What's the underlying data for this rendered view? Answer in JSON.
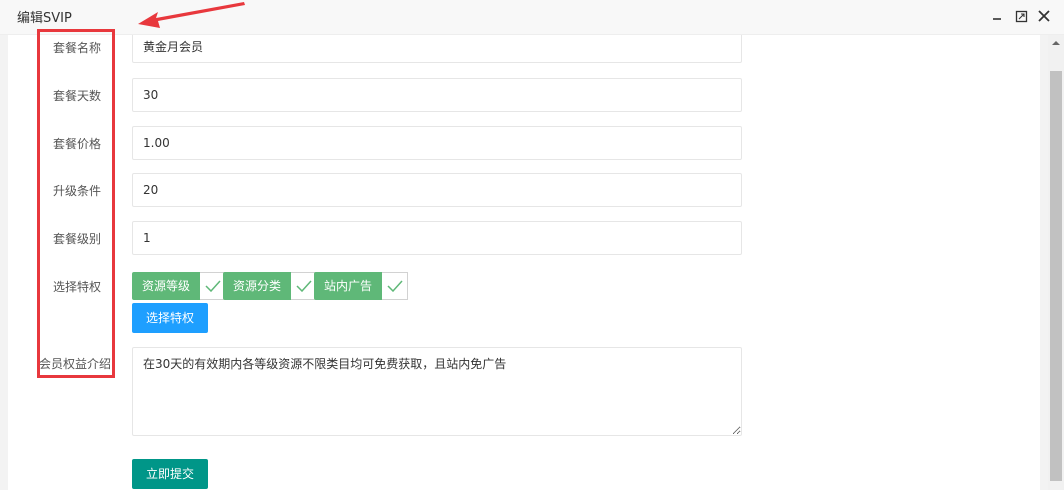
{
  "window": {
    "title": "编辑SVIP",
    "minimize_icon": "minimize-icon",
    "maximize_icon": "maximize-icon",
    "close_icon": "close-icon"
  },
  "form": {
    "name": {
      "label": "套餐名称",
      "value": "黄金月会员"
    },
    "days": {
      "label": "套餐天数",
      "value": "30"
    },
    "price": {
      "label": "套餐价格",
      "value": "1.00"
    },
    "upgrade": {
      "label": "升级条件",
      "value": "20"
    },
    "level": {
      "label": "套餐级别",
      "value": "1"
    },
    "privileges": {
      "label": "选择特权",
      "items": [
        {
          "label": "资源等级",
          "checked": true
        },
        {
          "label": "资源分类",
          "checked": true
        },
        {
          "label": "站内广告",
          "checked": true
        }
      ],
      "select_button": "选择特权"
    },
    "description": {
      "label": "会员权益介绍",
      "value": "在30天的有效期内各等级资源不限类目均可免费获取，且站内免广告"
    },
    "submit_button": "立即提交"
  },
  "colors": {
    "tag_green": "#5fb878",
    "select_blue": "#1e9fff",
    "submit_teal": "#009688",
    "annotation_red": "#e8383d"
  }
}
